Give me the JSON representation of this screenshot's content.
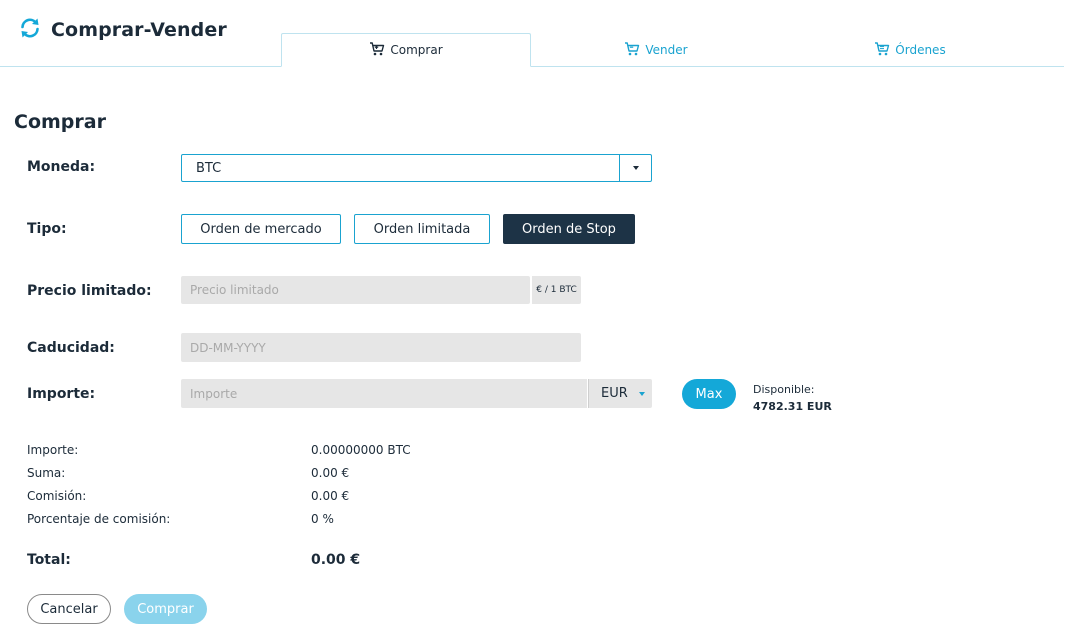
{
  "header": {
    "title": "Comprar-Vender",
    "logo_icon": "refresh-arrows-icon",
    "accent_color": "#1aa3d0"
  },
  "tabs": [
    {
      "label": "Comprar",
      "icon": "cart-icon",
      "active": true
    },
    {
      "label": "Vender",
      "icon": "cart-icon",
      "active": false
    },
    {
      "label": "Órdenes",
      "icon": "cart-icon",
      "active": false
    }
  ],
  "form": {
    "title": "Comprar",
    "currency": {
      "label": "Moneda:",
      "value": "BTC"
    },
    "type": {
      "label": "Tipo:",
      "options": [
        "Orden de mercado",
        "Orden limitada",
        "Orden de Stop"
      ],
      "selected": "Orden de Stop"
    },
    "limit_price": {
      "label": "Precio limitado:",
      "placeholder": "Precio limitado",
      "unit": "€ / 1 BTC"
    },
    "expiry": {
      "label": "Caducidad:",
      "placeholder": "DD-MM-YYYY"
    },
    "amount": {
      "label": "Importe:",
      "placeholder": "Importe",
      "currency": "EUR",
      "max_label": "Max",
      "available_label": "Disponible:",
      "available_value": "4782.31 EUR"
    }
  },
  "summary": {
    "rows": [
      {
        "label": "Importe:",
        "value": "0.00000000 BTC"
      },
      {
        "label": "Suma:",
        "value": "0.00 €"
      },
      {
        "label": "Comisión:",
        "value": "0.00 €"
      },
      {
        "label": "Porcentaje de comisión:",
        "value": "0 %"
      }
    ],
    "total_label": "Total:",
    "total_value": "0.00 €"
  },
  "actions": {
    "cancel": "Cancelar",
    "submit": "Comprar"
  }
}
